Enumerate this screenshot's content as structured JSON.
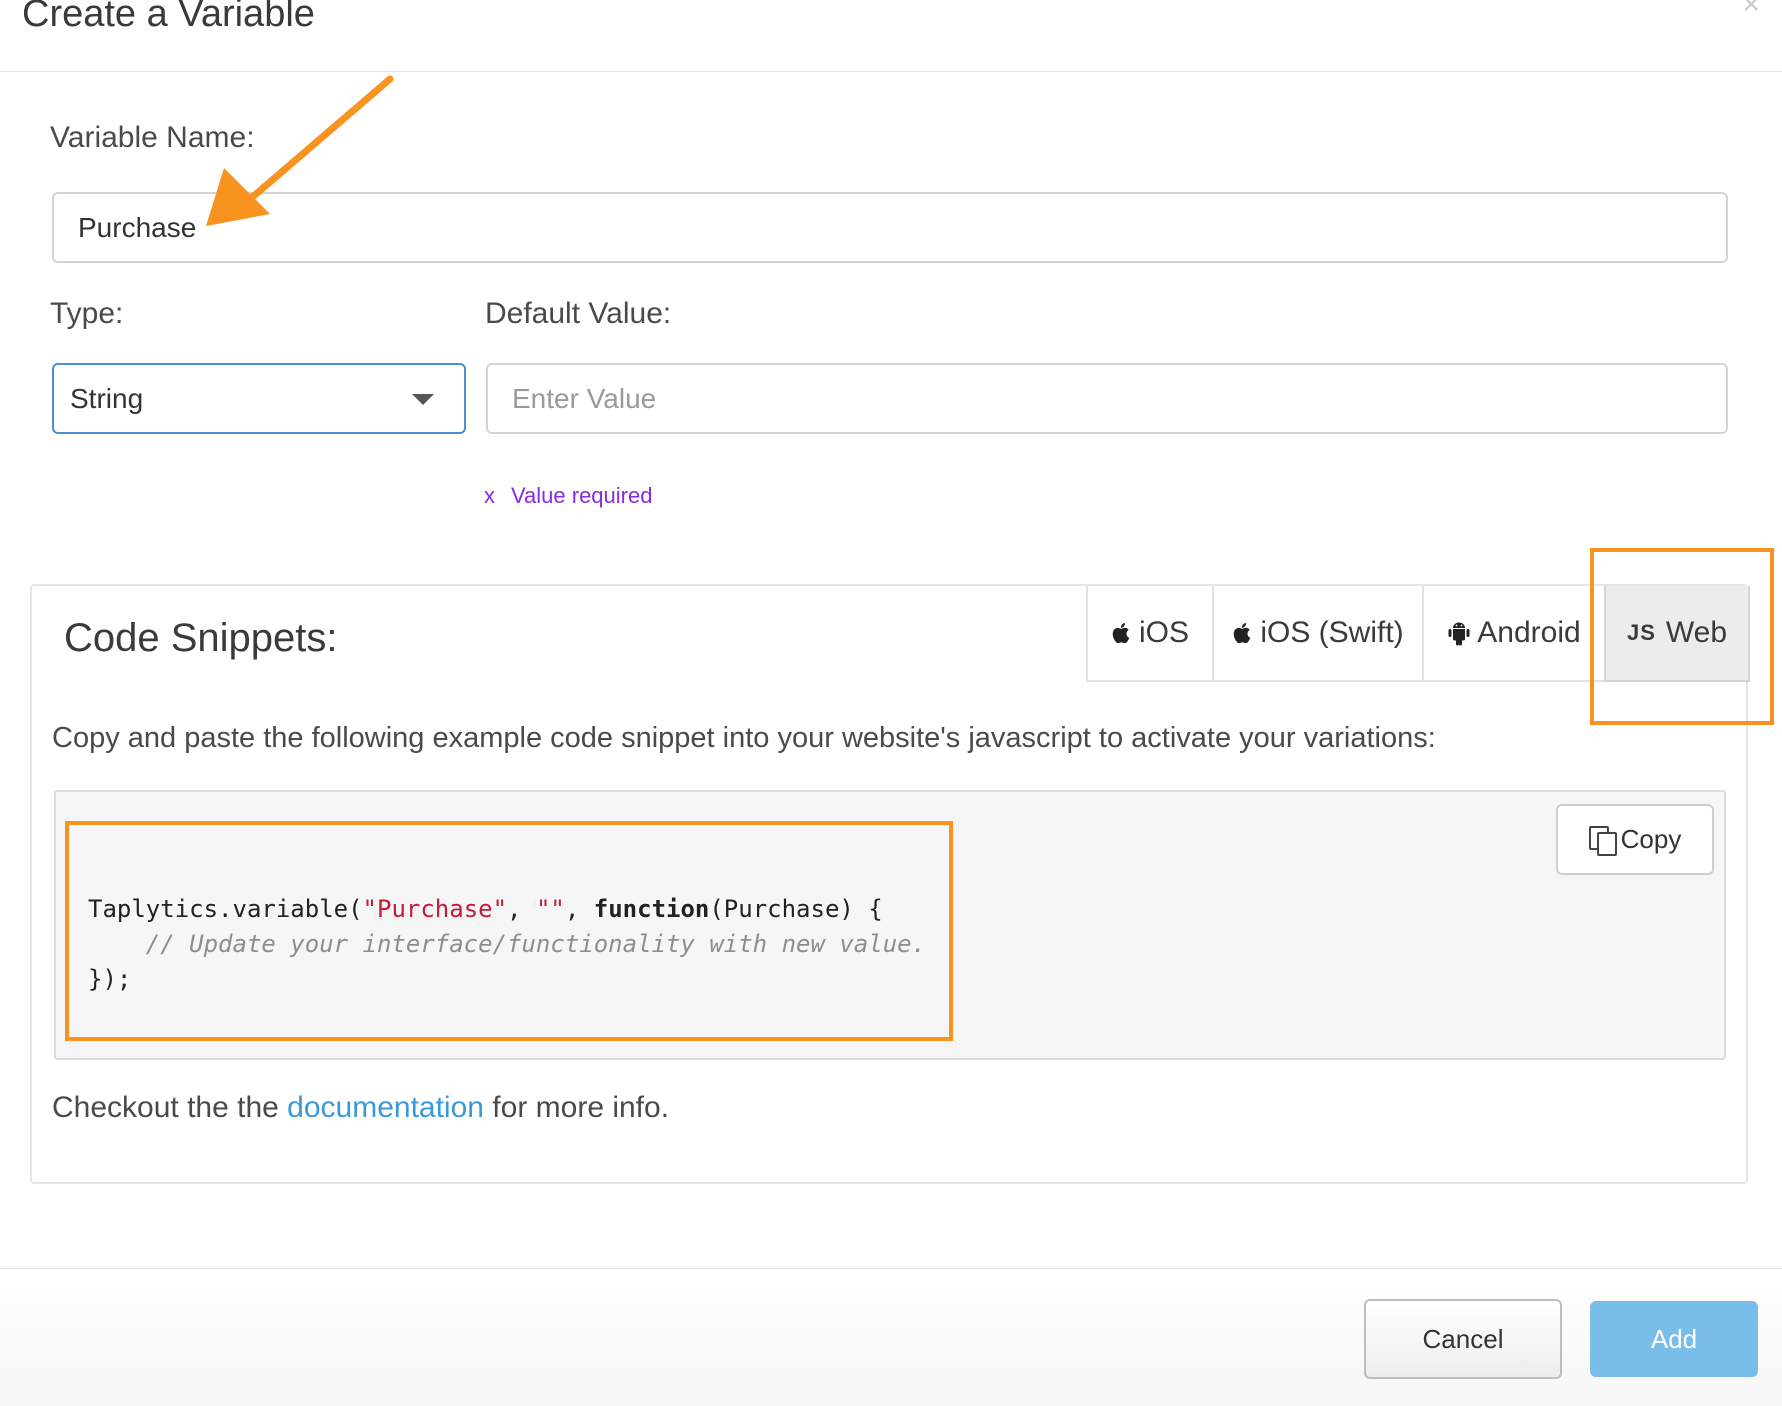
{
  "modal": {
    "title": "Create a Variable",
    "close_label": "×"
  },
  "form": {
    "name_label": "Variable Name:",
    "name_value": "Purchase",
    "type_label": "Type:",
    "type_selected": "String",
    "default_label": "Default Value:",
    "default_placeholder": "Enter Value",
    "validation_mark": "x",
    "validation_message": "Value required"
  },
  "snippets": {
    "title": "Code Snippets:",
    "tabs": [
      {
        "label": "iOS",
        "icon": "apple-icon",
        "active": false
      },
      {
        "label": "iOS (Swift)",
        "icon": "apple-icon",
        "active": false
      },
      {
        "label": "Android",
        "icon": "android-icon",
        "active": false
      },
      {
        "label": "Web",
        "icon": "js-icon",
        "icon_text": "JS",
        "active": true
      }
    ],
    "description": "Copy and paste the following example code snippet into your website's javascript to activate your variations:",
    "copy_label": "Copy",
    "code": {
      "line1_prefix": "Taplytics.variable(",
      "line1_str1": "\"Purchase\"",
      "line1_sep": ", ",
      "line1_str2": "\"\"",
      "line1_sep2": ", ",
      "line1_kw": "function",
      "line1_suffix": "(Purchase) {",
      "line2_indent": "    ",
      "line2_comment": "// Update your interface/functionality with new value.",
      "line3": "});"
    },
    "footer_prefix": "Checkout the the ",
    "footer_link": "documentation",
    "footer_suffix": " for more info."
  },
  "actions": {
    "cancel_label": "Cancel",
    "add_label": "Add"
  },
  "colors": {
    "accent_annotation": "#f7931e",
    "link": "#3a9ad9",
    "add_button": "#79bde9",
    "validation": "#8a2be2",
    "code_string": "#c41a3b"
  }
}
